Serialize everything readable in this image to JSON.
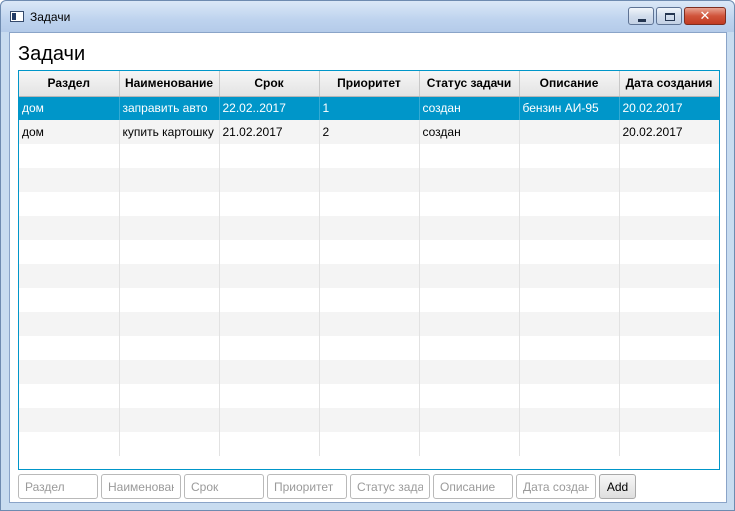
{
  "window": {
    "title": "Задачи"
  },
  "page": {
    "title": "Задачи"
  },
  "table": {
    "columns": [
      "Раздел",
      "Наименование",
      "Срок",
      "Приоритет",
      "Статус задачи",
      "Описание",
      "Дата создания"
    ],
    "rows": [
      [
        "дом",
        "заправить авто",
        "22.02..2017",
        "1",
        "создан",
        "бензин АИ-95",
        "20.02.2017"
      ],
      [
        "дом",
        "купить картошку",
        "21.02.2017",
        "2",
        "создан",
        "",
        "20.02.2017"
      ]
    ],
    "selected_row": 0
  },
  "form": {
    "placeholders": [
      "Раздел",
      "Наименование",
      "Срок",
      "Приоритет",
      "Статус задачи",
      "Описание",
      "Дата создания"
    ],
    "add_label": "Add"
  }
}
